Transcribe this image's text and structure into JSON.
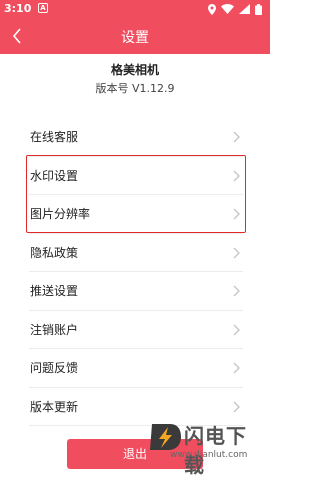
{
  "status_bar": {
    "time": "3:10",
    "notification_letter": "A"
  },
  "app_bar": {
    "title": "设置"
  },
  "app_info": {
    "name": "格美相机",
    "version": "版本号 V1.12.9"
  },
  "menu": {
    "items": [
      {
        "label": "在线客服"
      },
      {
        "label": "水印设置"
      },
      {
        "label": "图片分辨率"
      },
      {
        "label": "隐私政策"
      },
      {
        "label": "推送设置"
      },
      {
        "label": "注销账户"
      },
      {
        "label": "问题反馈"
      },
      {
        "label": "版本更新"
      }
    ]
  },
  "logout": {
    "label": "退出"
  },
  "watermark": {
    "name": "闪电下载",
    "url": "www.dianlut.com"
  },
  "colors": {
    "accent": "#f04e5f",
    "highlight": "#e02a2a"
  }
}
